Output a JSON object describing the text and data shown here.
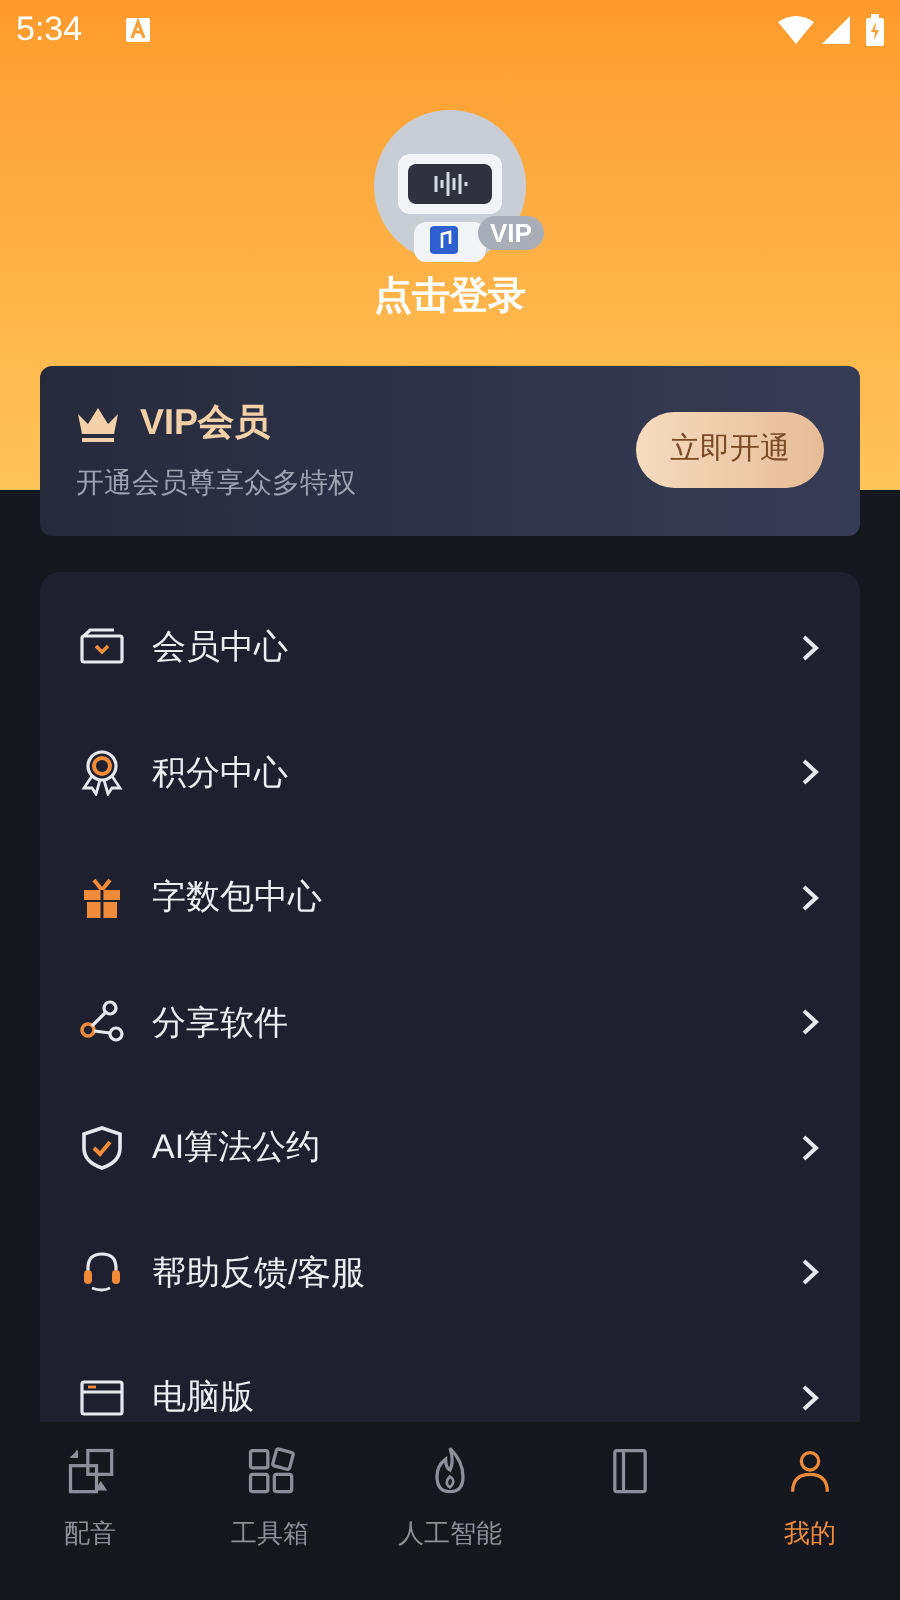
{
  "status_bar": {
    "time": "5:34"
  },
  "profile": {
    "badge": "VIP",
    "login": "点击登录"
  },
  "vip_card": {
    "title": "VIP会员",
    "subtitle": "开通会员尊享众多特权",
    "button": "立即开通"
  },
  "menu": [
    {
      "kind": "card",
      "label": "会员中心"
    },
    {
      "kind": "medal",
      "label": "积分中心"
    },
    {
      "kind": "gift",
      "label": "字数包中心"
    },
    {
      "kind": "share",
      "label": "分享软件"
    },
    {
      "kind": "shield",
      "label": "AI算法公约"
    },
    {
      "kind": "headset",
      "label": "帮助反馈/客服"
    },
    {
      "kind": "window",
      "label": "电脑版"
    }
  ],
  "tabs": [
    {
      "kind": "dub",
      "label": "配音",
      "selected": false
    },
    {
      "kind": "tools",
      "label": "工具箱",
      "selected": false
    },
    {
      "kind": "ai",
      "label": "人工智能",
      "selected": false
    },
    {
      "kind": "works",
      "selected": false
    },
    {
      "kind": "me",
      "label": "我的",
      "selected": true
    }
  ]
}
